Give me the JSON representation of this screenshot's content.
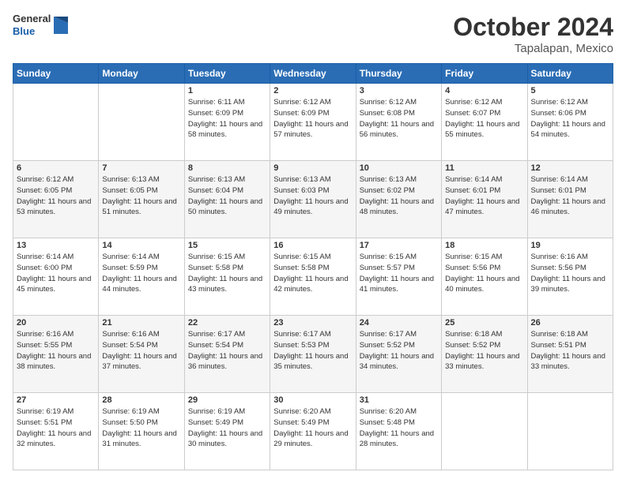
{
  "header": {
    "logo_general": "General",
    "logo_blue": "Blue",
    "month": "October 2024",
    "location": "Tapalapan, Mexico"
  },
  "weekdays": [
    "Sunday",
    "Monday",
    "Tuesday",
    "Wednesday",
    "Thursday",
    "Friday",
    "Saturday"
  ],
  "weeks": [
    [
      {
        "day": "",
        "sunrise": "",
        "sunset": "",
        "daylight": ""
      },
      {
        "day": "",
        "sunrise": "",
        "sunset": "",
        "daylight": ""
      },
      {
        "day": "1",
        "sunrise": "Sunrise: 6:11 AM",
        "sunset": "Sunset: 6:09 PM",
        "daylight": "Daylight: 11 hours and 58 minutes."
      },
      {
        "day": "2",
        "sunrise": "Sunrise: 6:12 AM",
        "sunset": "Sunset: 6:09 PM",
        "daylight": "Daylight: 11 hours and 57 minutes."
      },
      {
        "day": "3",
        "sunrise": "Sunrise: 6:12 AM",
        "sunset": "Sunset: 6:08 PM",
        "daylight": "Daylight: 11 hours and 56 minutes."
      },
      {
        "day": "4",
        "sunrise": "Sunrise: 6:12 AM",
        "sunset": "Sunset: 6:07 PM",
        "daylight": "Daylight: 11 hours and 55 minutes."
      },
      {
        "day": "5",
        "sunrise": "Sunrise: 6:12 AM",
        "sunset": "Sunset: 6:06 PM",
        "daylight": "Daylight: 11 hours and 54 minutes."
      }
    ],
    [
      {
        "day": "6",
        "sunrise": "Sunrise: 6:12 AM",
        "sunset": "Sunset: 6:05 PM",
        "daylight": "Daylight: 11 hours and 53 minutes."
      },
      {
        "day": "7",
        "sunrise": "Sunrise: 6:13 AM",
        "sunset": "Sunset: 6:05 PM",
        "daylight": "Daylight: 11 hours and 51 minutes."
      },
      {
        "day": "8",
        "sunrise": "Sunrise: 6:13 AM",
        "sunset": "Sunset: 6:04 PM",
        "daylight": "Daylight: 11 hours and 50 minutes."
      },
      {
        "day": "9",
        "sunrise": "Sunrise: 6:13 AM",
        "sunset": "Sunset: 6:03 PM",
        "daylight": "Daylight: 11 hours and 49 minutes."
      },
      {
        "day": "10",
        "sunrise": "Sunrise: 6:13 AM",
        "sunset": "Sunset: 6:02 PM",
        "daylight": "Daylight: 11 hours and 48 minutes."
      },
      {
        "day": "11",
        "sunrise": "Sunrise: 6:14 AM",
        "sunset": "Sunset: 6:01 PM",
        "daylight": "Daylight: 11 hours and 47 minutes."
      },
      {
        "day": "12",
        "sunrise": "Sunrise: 6:14 AM",
        "sunset": "Sunset: 6:01 PM",
        "daylight": "Daylight: 11 hours and 46 minutes."
      }
    ],
    [
      {
        "day": "13",
        "sunrise": "Sunrise: 6:14 AM",
        "sunset": "Sunset: 6:00 PM",
        "daylight": "Daylight: 11 hours and 45 minutes."
      },
      {
        "day": "14",
        "sunrise": "Sunrise: 6:14 AM",
        "sunset": "Sunset: 5:59 PM",
        "daylight": "Daylight: 11 hours and 44 minutes."
      },
      {
        "day": "15",
        "sunrise": "Sunrise: 6:15 AM",
        "sunset": "Sunset: 5:58 PM",
        "daylight": "Daylight: 11 hours and 43 minutes."
      },
      {
        "day": "16",
        "sunrise": "Sunrise: 6:15 AM",
        "sunset": "Sunset: 5:58 PM",
        "daylight": "Daylight: 11 hours and 42 minutes."
      },
      {
        "day": "17",
        "sunrise": "Sunrise: 6:15 AM",
        "sunset": "Sunset: 5:57 PM",
        "daylight": "Daylight: 11 hours and 41 minutes."
      },
      {
        "day": "18",
        "sunrise": "Sunrise: 6:15 AM",
        "sunset": "Sunset: 5:56 PM",
        "daylight": "Daylight: 11 hours and 40 minutes."
      },
      {
        "day": "19",
        "sunrise": "Sunrise: 6:16 AM",
        "sunset": "Sunset: 5:56 PM",
        "daylight": "Daylight: 11 hours and 39 minutes."
      }
    ],
    [
      {
        "day": "20",
        "sunrise": "Sunrise: 6:16 AM",
        "sunset": "Sunset: 5:55 PM",
        "daylight": "Daylight: 11 hours and 38 minutes."
      },
      {
        "day": "21",
        "sunrise": "Sunrise: 6:16 AM",
        "sunset": "Sunset: 5:54 PM",
        "daylight": "Daylight: 11 hours and 37 minutes."
      },
      {
        "day": "22",
        "sunrise": "Sunrise: 6:17 AM",
        "sunset": "Sunset: 5:54 PM",
        "daylight": "Daylight: 11 hours and 36 minutes."
      },
      {
        "day": "23",
        "sunrise": "Sunrise: 6:17 AM",
        "sunset": "Sunset: 5:53 PM",
        "daylight": "Daylight: 11 hours and 35 minutes."
      },
      {
        "day": "24",
        "sunrise": "Sunrise: 6:17 AM",
        "sunset": "Sunset: 5:52 PM",
        "daylight": "Daylight: 11 hours and 34 minutes."
      },
      {
        "day": "25",
        "sunrise": "Sunrise: 6:18 AM",
        "sunset": "Sunset: 5:52 PM",
        "daylight": "Daylight: 11 hours and 33 minutes."
      },
      {
        "day": "26",
        "sunrise": "Sunrise: 6:18 AM",
        "sunset": "Sunset: 5:51 PM",
        "daylight": "Daylight: 11 hours and 33 minutes."
      }
    ],
    [
      {
        "day": "27",
        "sunrise": "Sunrise: 6:19 AM",
        "sunset": "Sunset: 5:51 PM",
        "daylight": "Daylight: 11 hours and 32 minutes."
      },
      {
        "day": "28",
        "sunrise": "Sunrise: 6:19 AM",
        "sunset": "Sunset: 5:50 PM",
        "daylight": "Daylight: 11 hours and 31 minutes."
      },
      {
        "day": "29",
        "sunrise": "Sunrise: 6:19 AM",
        "sunset": "Sunset: 5:49 PM",
        "daylight": "Daylight: 11 hours and 30 minutes."
      },
      {
        "day": "30",
        "sunrise": "Sunrise: 6:20 AM",
        "sunset": "Sunset: 5:49 PM",
        "daylight": "Daylight: 11 hours and 29 minutes."
      },
      {
        "day": "31",
        "sunrise": "Sunrise: 6:20 AM",
        "sunset": "Sunset: 5:48 PM",
        "daylight": "Daylight: 11 hours and 28 minutes."
      },
      {
        "day": "",
        "sunrise": "",
        "sunset": "",
        "daylight": ""
      },
      {
        "day": "",
        "sunrise": "",
        "sunset": "",
        "daylight": ""
      }
    ]
  ]
}
